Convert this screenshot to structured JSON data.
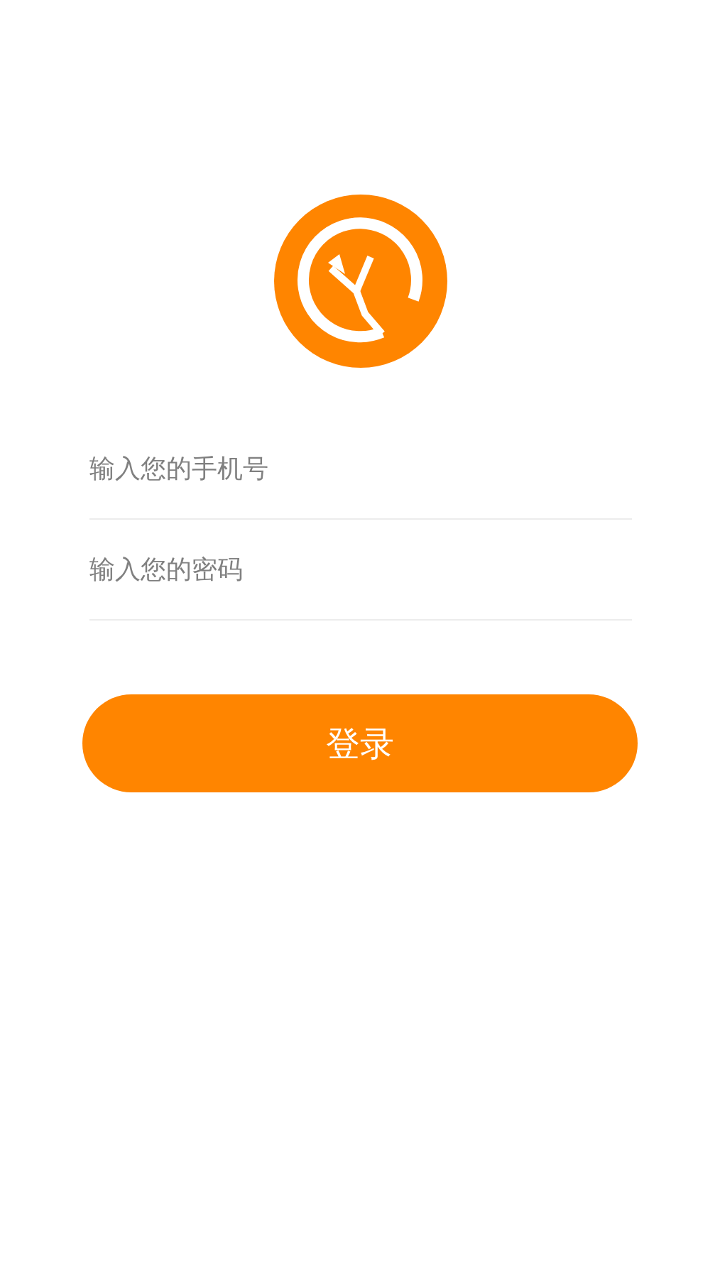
{
  "fields": [
    {
      "placeholder": "输入您的手机号"
    },
    {
      "placeholder": "输入您的密码"
    }
  ],
  "login_button": {
    "label": "登录"
  }
}
